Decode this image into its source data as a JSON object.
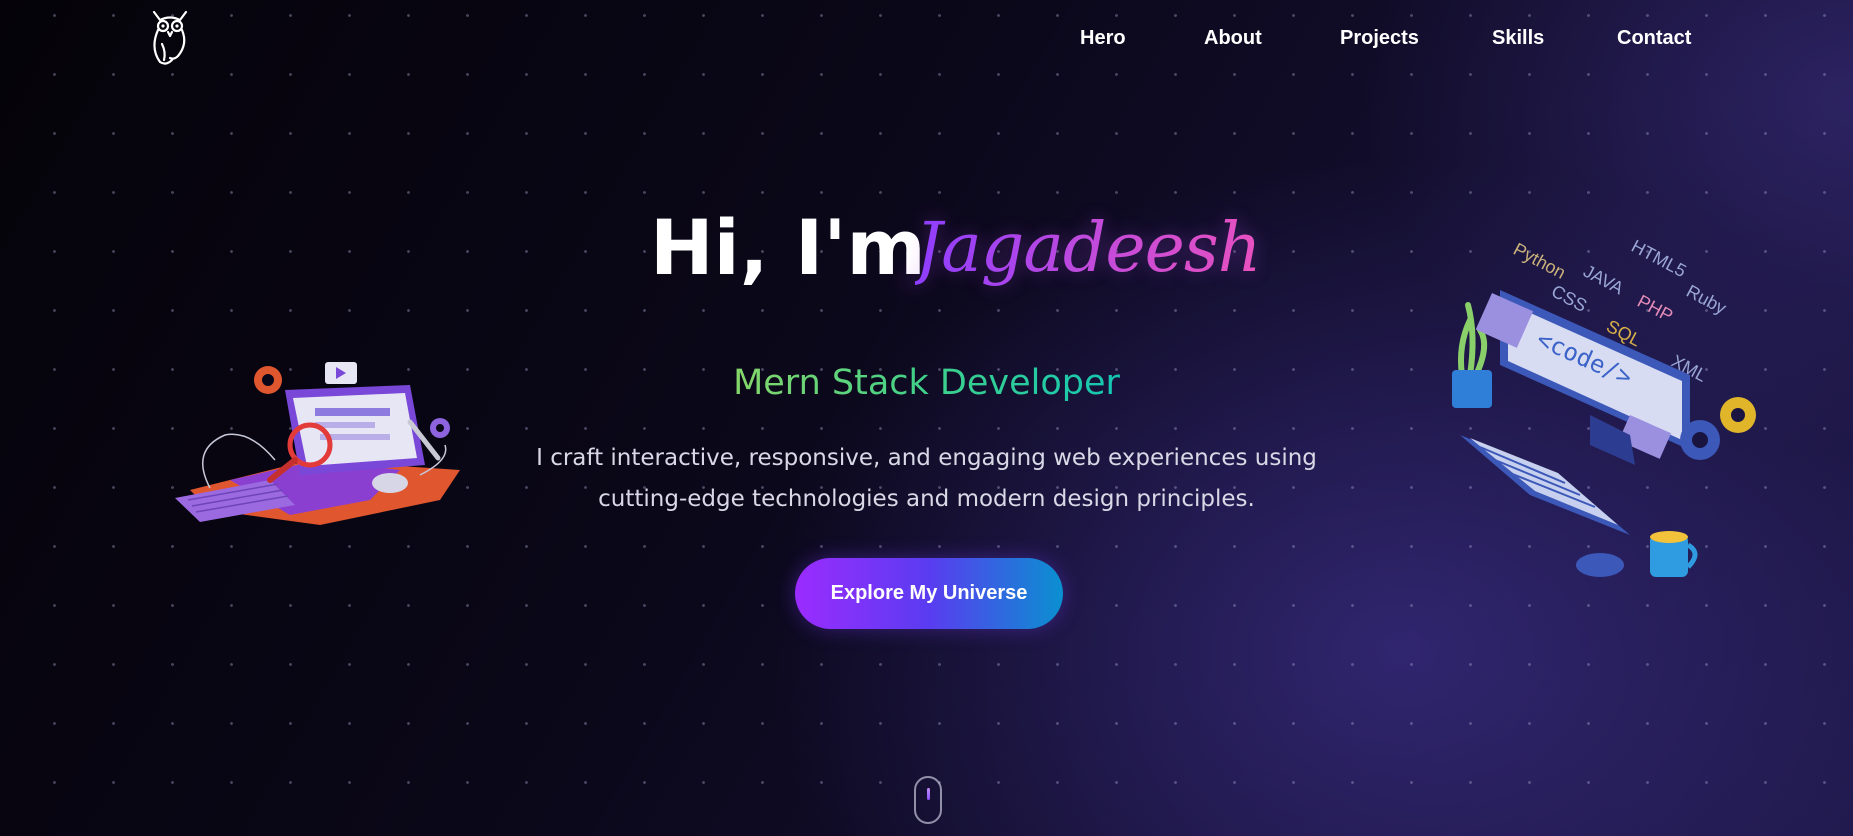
{
  "nav": {
    "logo_icon": "owl-logo-icon",
    "items": [
      {
        "label": "Hero"
      },
      {
        "label": "About"
      },
      {
        "label": "Projects"
      },
      {
        "label": "Skills"
      },
      {
        "label": "Contact"
      }
    ]
  },
  "hero": {
    "greeting": "Hi, I'm",
    "name": "Jagadeesh",
    "role": "Mern Stack Developer",
    "description": "I craft interactive, responsive, and engaging web experiences using cutting-edge technologies and modern design principles.",
    "cta_label": "Explore My Universe"
  },
  "illustration_right": {
    "languages": [
      "Python",
      "JAVA",
      "HTML5",
      "CSS",
      "PHP",
      "Ruby",
      "SQL",
      "XML"
    ],
    "screen_text": "<code/>"
  },
  "colors": {
    "accent_purple": "#9b2cff",
    "accent_blue": "#0a90d0",
    "name_gradient_start": "#8b3dff",
    "name_gradient_end": "#ee52b9",
    "role_gradient_start": "#86d66a",
    "role_gradient_end": "#14c7b3"
  },
  "scroll_indicator_icon": "mouse-scroll-icon"
}
